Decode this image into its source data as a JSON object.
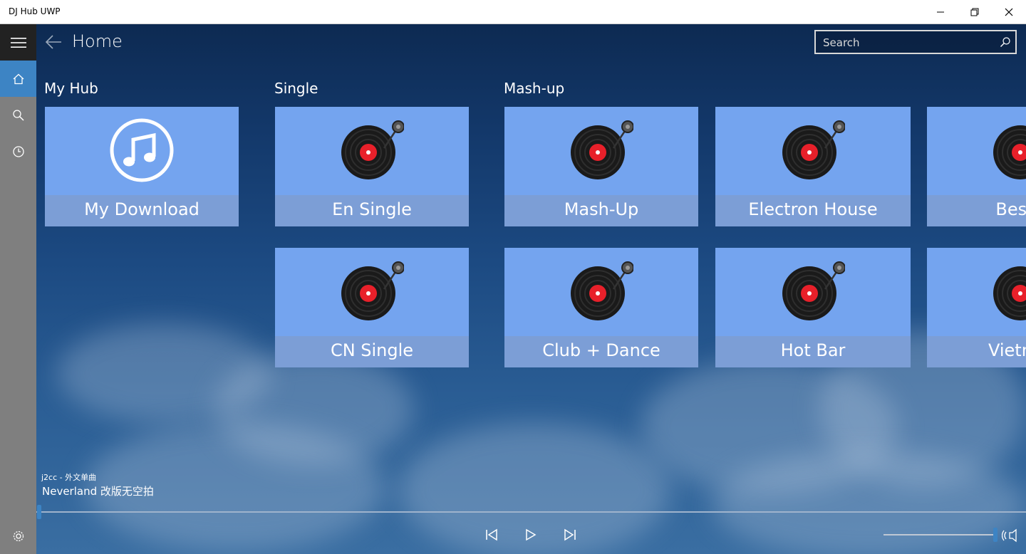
{
  "window": {
    "title": "DJ Hub UWP",
    "controls": {
      "minimize": "minimize-icon",
      "restore": "restore-icon",
      "close": "close-icon"
    }
  },
  "sidebar": {
    "items": [
      {
        "name": "hamburger-menu",
        "icon": "menu-icon"
      },
      {
        "name": "home",
        "icon": "home-icon",
        "active": true
      },
      {
        "name": "search",
        "icon": "search-icon"
      },
      {
        "name": "history",
        "icon": "clock-icon"
      }
    ],
    "footer_icon": "gear-icon"
  },
  "header": {
    "back_icon": "back-arrow-icon",
    "title": "Home",
    "search": {
      "placeholder": "Search",
      "value": ""
    }
  },
  "sections": {
    "my_hub": {
      "label": "My Hub",
      "tiles": [
        {
          "label": "My Download",
          "icon": "music-note-icon"
        }
      ]
    },
    "single": {
      "label": "Single",
      "tiles": [
        {
          "label": "En Single",
          "icon": "vinyl-record-icon"
        },
        {
          "label": "CN Single",
          "icon": "vinyl-record-icon"
        }
      ]
    },
    "mashup": {
      "label": "Mash-up",
      "tiles": [
        {
          "label": "Mash-Up",
          "icon": "vinyl-record-icon"
        },
        {
          "label": "Electron House",
          "icon": "vinyl-record-icon"
        },
        {
          "label": "Best D",
          "icon": "vinyl-record-icon"
        },
        {
          "label": "Club + Dance",
          "icon": "vinyl-record-icon"
        },
        {
          "label": "Hot Bar",
          "icon": "vinyl-record-icon"
        },
        {
          "label": "Vietnam",
          "icon": "vinyl-record-icon"
        }
      ]
    }
  },
  "now_playing": {
    "artist": "j2cc - 外文单曲",
    "song": "Neverland 改版无空拍",
    "progress": 0.002
  },
  "player": {
    "controls": [
      "previous-icon",
      "play-icon",
      "next-icon"
    ],
    "volume": 1.0,
    "volume_icon": "speaker-icon"
  },
  "colors": {
    "accent": "#3d84c4",
    "tile": "#74a4ef",
    "tile_label": "#7c9ed6",
    "sidebar": "#7f7f7f"
  }
}
